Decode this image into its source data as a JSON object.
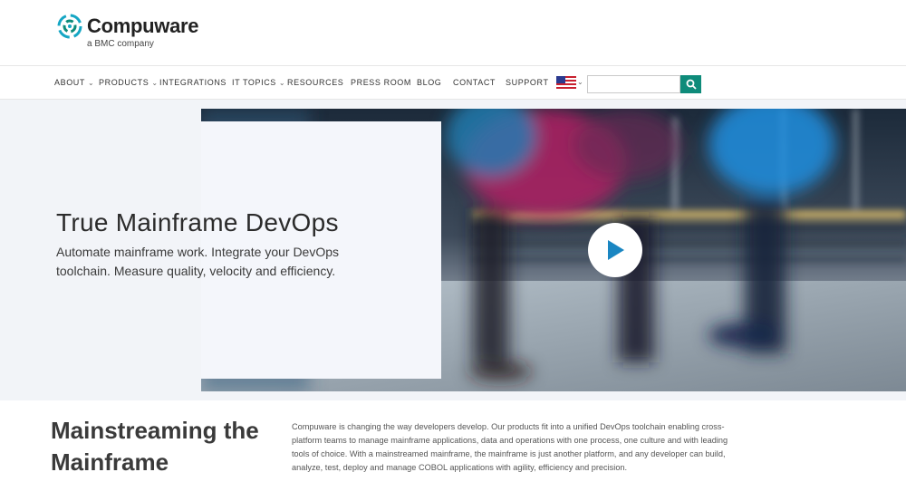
{
  "brand": {
    "name": "Compuware",
    "tagline": "a BMC company",
    "accent_color": "#0e8b7a"
  },
  "nav": {
    "items": [
      {
        "label": "ABOUT",
        "has_dropdown": true
      },
      {
        "label": "PRODUCTS",
        "has_dropdown": true
      },
      {
        "label": "INTEGRATIONS",
        "has_dropdown": false
      },
      {
        "label": "IT TOPICS",
        "has_dropdown": true
      },
      {
        "label": "RESOURCES",
        "has_dropdown": false
      },
      {
        "label": "PRESS ROOM",
        "has_dropdown": false
      },
      {
        "label": "BLOG",
        "has_dropdown": false
      },
      {
        "label": "CONTACT",
        "has_dropdown": false
      },
      {
        "label": "SUPPORT",
        "has_dropdown": false
      }
    ],
    "language_icon": "us-flag-icon",
    "search": {
      "value": "",
      "placeholder": "",
      "button_icon": "search-icon"
    }
  },
  "hero": {
    "title": "True Mainframe DevOps",
    "subtitle": "Automate mainframe work. Integrate your DevOps toolchain. Measure quality, velocity and efficiency.",
    "play_icon": "play-icon"
  },
  "section": {
    "heading": "Mainstreaming the Mainframe",
    "body": "Compuware is changing the way developers develop. Our products fit into a unified DevOps toolchain enabling cross-platform teams to manage mainframe applications, data and operations with one process, one culture and with leading tools of choice. With a mainstreamed mainframe, the mainframe is just another platform, and any developer can build, analyze, test, deploy and manage COBOL applications with agility, efficiency and precision."
  }
}
